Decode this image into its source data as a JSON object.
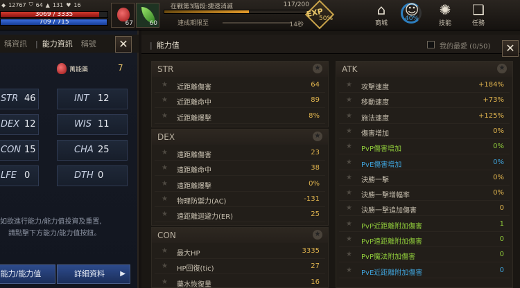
{
  "hud": {
    "stats": [
      "12767",
      "64",
      "131",
      "16"
    ],
    "hp": {
      "current": 3069,
      "max": 3335,
      "text": "3069 / 3335"
    },
    "mp": {
      "current": 709,
      "max": 715,
      "text": "709 / 715"
    },
    "potion_count": "67",
    "leaf_count": "60",
    "quest": {
      "name": "在戰第3階段:捷速消滅",
      "count": "117/200",
      "progress": 0.585,
      "sub_label": "速成期限至",
      "sub_value": "14秒"
    },
    "exp": {
      "label": "EXP",
      "percent": "50%"
    },
    "menu": {
      "shop": "商城",
      "ring_percent": "40%",
      "skill": "技能",
      "quest": "任務"
    }
  },
  "left_panel": {
    "tabs": [
      "稱資訊",
      "能力資訊",
      "稱號"
    ],
    "active_tab": 1,
    "flask_label": "萬能藥",
    "points": "7",
    "stats": [
      {
        "name": "STR",
        "value": "46"
      },
      {
        "name": "INT",
        "value": "12"
      },
      {
        "name": "DEX",
        "value": "12"
      },
      {
        "name": "WIS",
        "value": "11"
      },
      {
        "name": "CON",
        "value": "15"
      },
      {
        "name": "CHA",
        "value": "25"
      },
      {
        "name": "LFE",
        "value": "0"
      },
      {
        "name": "DTH",
        "value": "0"
      }
    ],
    "note_lines": [
      "如欲進行能力/能力值投資及重置,",
      "請點擊下方能力/能力值按鈕。"
    ],
    "buttons": {
      "allocate": "能力/能力值",
      "detail": "詳細資料"
    }
  },
  "right_panel": {
    "title": "能力值",
    "favorite_label": "我的最愛 (0/50)",
    "cards": {
      "str": {
        "title": "STR",
        "rows": [
          {
            "name": "近距離傷害",
            "value": "64"
          },
          {
            "name": "近距離命中",
            "value": "89"
          },
          {
            "name": "近距離爆擊",
            "value": "8%"
          }
        ]
      },
      "dex": {
        "title": "DEX",
        "rows": [
          {
            "name": "遠距離傷害",
            "value": "23"
          },
          {
            "name": "遠距離命中",
            "value": "38"
          },
          {
            "name": "遠距離爆擊",
            "value": "0%"
          },
          {
            "name": "物理防禦力(AC)",
            "value": "-131"
          },
          {
            "name": "遠距離迴避力(ER)",
            "value": "25"
          }
        ]
      },
      "con": {
        "title": "CON",
        "rows": [
          {
            "name": "最大HP",
            "value": "3335"
          },
          {
            "name": "HP回復(tic)",
            "value": "27"
          },
          {
            "name": "藥水恢復量",
            "value": "16"
          }
        ]
      },
      "atk": {
        "title": "ATK",
        "rows": [
          {
            "name": "攻擊速度",
            "value": "+184%"
          },
          {
            "name": "移動速度",
            "value": "+73%"
          },
          {
            "name": "施法速度",
            "value": "+125%"
          },
          {
            "name": "傷害增加",
            "value": "0%"
          },
          {
            "name": "PvP傷害增加",
            "value": "0%"
          },
          {
            "name": "PvE傷害增加",
            "value": "0%"
          },
          {
            "name": "決勝一擊",
            "value": "0%"
          },
          {
            "name": "決勝一擊增幅率",
            "value": "0%"
          },
          {
            "name": "決勝一擊追加傷害",
            "value": "0"
          },
          {
            "name": "PvP近距離附加傷害",
            "value": "1"
          },
          {
            "name": "PvP遠距離附加傷害",
            "value": "0"
          },
          {
            "name": "PvP魔法附加傷害",
            "value": "0"
          },
          {
            "name": "PvE近距離附加傷害",
            "value": "0"
          }
        ]
      }
    }
  },
  "colors": {
    "value_gold": "#e0b44e",
    "pvp_green": "#8ec93a",
    "pve_blue": "#3fa1d8",
    "button_blue": "#2d4b8c"
  }
}
